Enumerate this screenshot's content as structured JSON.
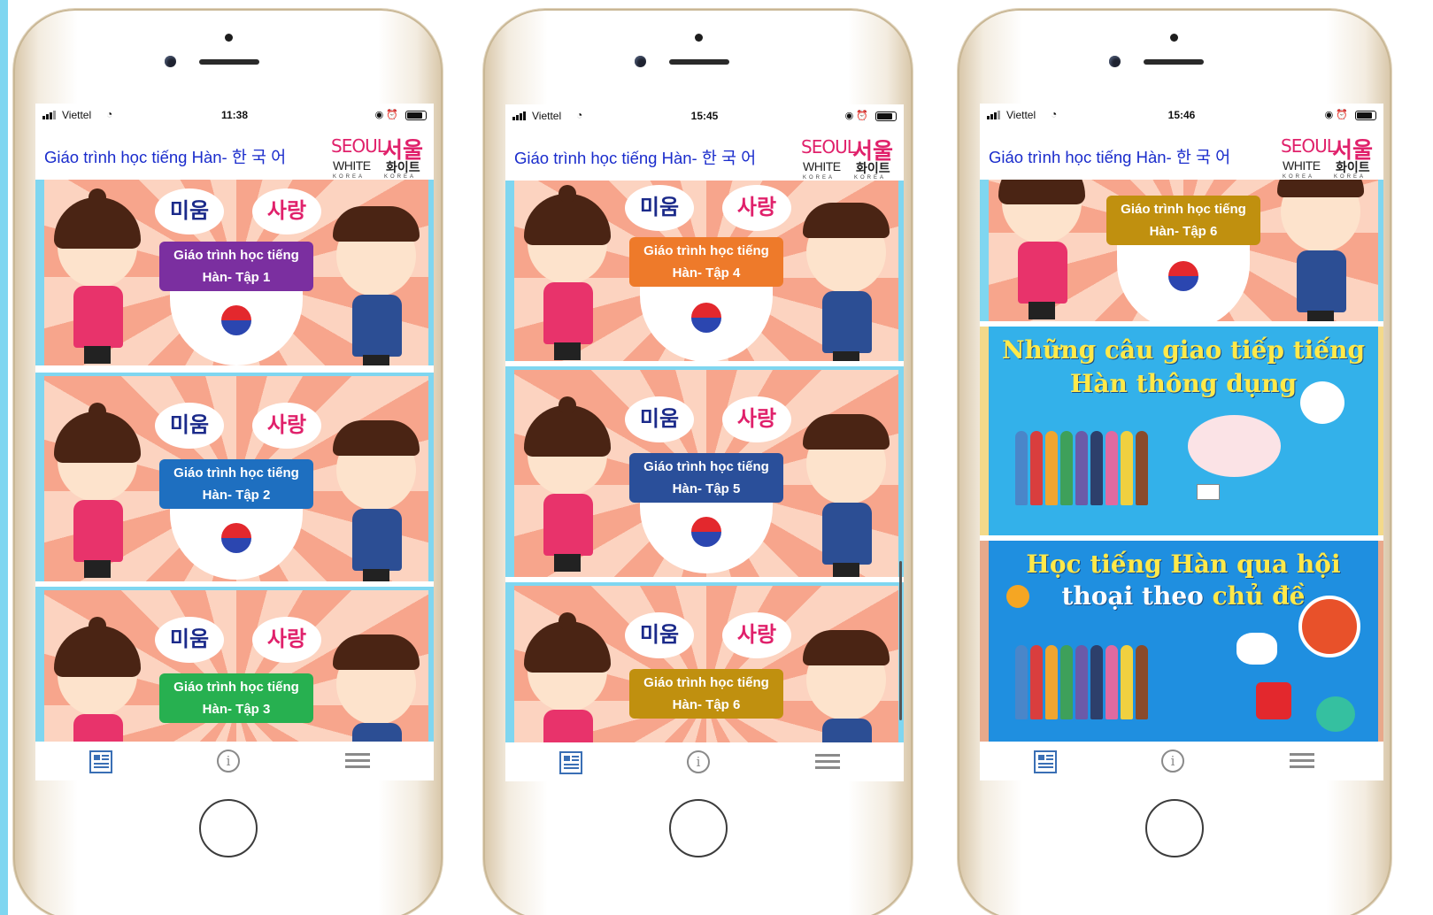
{
  "phones": [
    {
      "status": {
        "carrier": "Viettel",
        "time": "11:38"
      },
      "header": {
        "title": "Giáo trình học tiếng Hàn- 한 국 어"
      },
      "logo": {
        "seoul": "SEOUL",
        "korean": "서울",
        "white": "WHITE",
        "korean2": "화이트",
        "korea": "KOREA"
      },
      "cards": [
        {
          "label": "Giáo trình học tiếng Hàn- Tập 1",
          "color": "#7b2fa0"
        },
        {
          "label": "Giáo trình học tiếng Hàn- Tập 2",
          "color": "#1e6fc0"
        },
        {
          "label": "Giáo trình học tiếng Hàn- Tập 3",
          "color": "#27b050"
        }
      ]
    },
    {
      "status": {
        "carrier": "Viettel",
        "time": "15:45"
      },
      "header": {
        "title": "Giáo trình học tiếng Hàn- 한 국 어"
      },
      "logo": {
        "seoul": "SEOUL",
        "korean": "서울",
        "white": "WHITE",
        "korean2": "화이트",
        "korea": "KOREA"
      },
      "cards": [
        {
          "label": "Giáo trình học tiếng Hàn- Tập 4",
          "color": "#ee7a2a"
        },
        {
          "label": "Giáo trình học tiếng Hàn- Tập 5",
          "color": "#2a4f9a"
        },
        {
          "label": "Giáo trình học tiếng Hàn- Tập 6",
          "color": "#c0900f"
        }
      ]
    },
    {
      "status": {
        "carrier": "Viettel",
        "time": "15:46"
      },
      "header": {
        "title": "Giáo trình học tiếng Hàn- 한 국 어"
      },
      "logo": {
        "seoul": "SEOUL",
        "korean": "서울",
        "white": "WHITE",
        "korean2": "화이트",
        "korea": "KOREA"
      },
      "cards": [
        {
          "label": "Giáo trình học tiếng Hàn- Tập 6",
          "color": "#c0900f"
        }
      ],
      "banners": [
        {
          "line1": "Những câu giao tiếp tiếng",
          "line2": "Hàn thông dụng"
        },
        {
          "line1a": "Học tiếng Hàn qua ",
          "line1b": "hội",
          "line2a": "thoại theo ",
          "line2b": "chủ đề"
        }
      ]
    }
  ],
  "bubbles": {
    "left": "미움",
    "right": "사랑"
  },
  "tabbar": {
    "news_icon": "newspaper-icon",
    "info_icon": "info-icon",
    "menu_icon": "hamburger-menu-icon",
    "info_glyph": "i"
  },
  "colors": {
    "header_title": "#1a2ccc",
    "logo_pink": "#e0216b",
    "left_strip": "#7fd6f0"
  }
}
